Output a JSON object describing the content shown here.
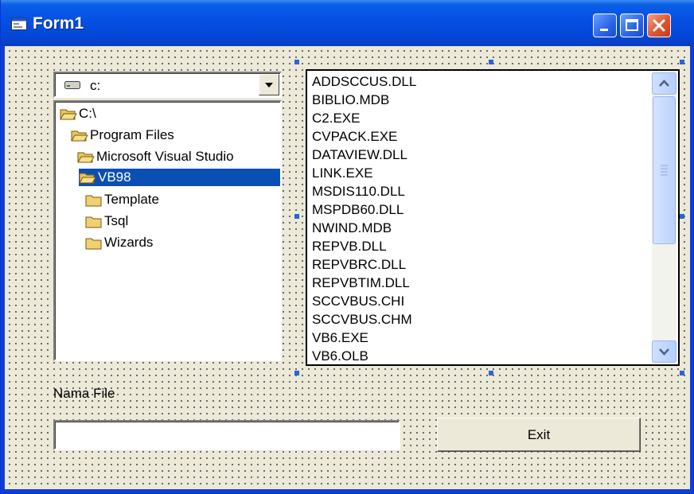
{
  "window": {
    "title": "Form1",
    "minimize_icon": "minimize-icon",
    "maximize_icon": "maximize-icon",
    "close_icon": "close-icon"
  },
  "drive_combo": {
    "selected": "c:",
    "icon": "drive-icon"
  },
  "dir_list": {
    "items": [
      "C:\\",
      "Program Files",
      "Microsoft Visual Studio",
      "VB98",
      "Template",
      "Tsql",
      "Wizards"
    ],
    "selected": "VB98"
  },
  "file_list": {
    "items": [
      "ADDSCCUS.DLL",
      "BIBLIO.MDB",
      "C2.EXE",
      "CVPACK.EXE",
      "DATAVIEW.DLL",
      "LINK.EXE",
      "MSDIS110.DLL",
      "MSPDB60.DLL",
      "NWIND.MDB",
      "REPVB.DLL",
      "REPVBRC.DLL",
      "REPVBTIM.DLL",
      "SCCVBUS.CHI",
      "SCCVBUS.CHM",
      "VB6.EXE",
      "VB6.OLB"
    ]
  },
  "label_nama_file": "Nama File",
  "textbox": {
    "value": ""
  },
  "exit_button": "Exit",
  "colors": {
    "titlebar": "#0551e3",
    "form_background": "#ece9d8",
    "selection": "#0a4fb4",
    "close_button": "#e0552f"
  }
}
